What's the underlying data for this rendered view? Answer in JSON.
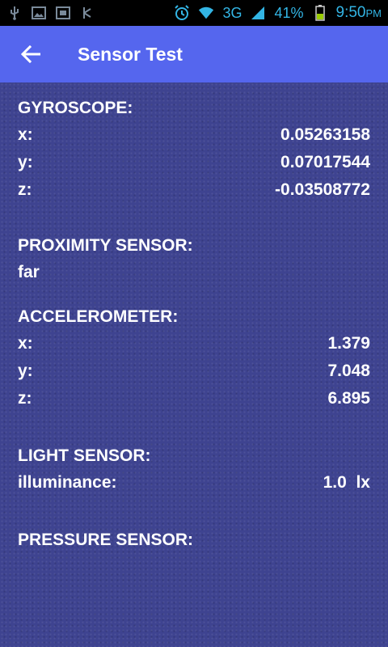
{
  "status_bar": {
    "icons_left": [
      "usb-icon",
      "image-icon",
      "screenshot-icon",
      "usb-debug-icon"
    ],
    "icons_right": [
      "alarm-icon",
      "wifi-icon",
      "signal-icon",
      "battery-icon"
    ],
    "network": "3G",
    "battery_percent": "41%",
    "time": "9:50",
    "ampm": "PM"
  },
  "appbar": {
    "title": "Sensor Test",
    "back_icon": "arrow-left-icon",
    "color": "#5566ee"
  },
  "gyroscope": {
    "title": "GYROSCOPE:",
    "rows": [
      {
        "label": "x:",
        "value": "0.05263158"
      },
      {
        "label": "y:",
        "value": "0.07017544"
      },
      {
        "label": "z:",
        "value": "-0.03508772"
      }
    ]
  },
  "proximity": {
    "title": "PROXIMITY SENSOR:",
    "value": "far"
  },
  "accelerometer": {
    "title": "ACCELEROMETER:",
    "rows": [
      {
        "label": "x:",
        "value": "1.379"
      },
      {
        "label": "y:",
        "value": "7.048"
      },
      {
        "label": "z:",
        "value": "6.895"
      }
    ]
  },
  "light": {
    "title": "LIGHT SENSOR:",
    "rows": [
      {
        "label": "illuminance:",
        "value": "1.0  lx"
      }
    ]
  },
  "pressure": {
    "title": "PRESSURE SENSOR:"
  },
  "colors": {
    "background": "#3e4390",
    "status_accent": "#33b5e5"
  }
}
